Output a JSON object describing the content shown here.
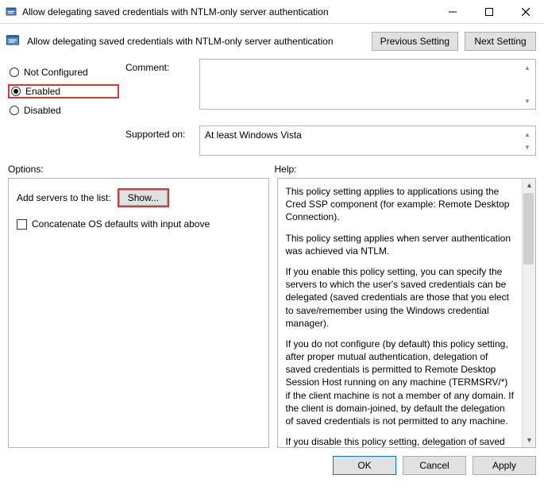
{
  "window": {
    "title": "Allow delegating saved credentials with NTLM-only server authentication"
  },
  "header": {
    "title": "Allow delegating saved credentials with NTLM-only server authentication",
    "prev_btn": "Previous Setting",
    "next_btn": "Next Setting"
  },
  "state": {
    "not_configured": "Not Configured",
    "enabled": "Enabled",
    "disabled": "Disabled",
    "selected": "enabled"
  },
  "labels": {
    "comment": "Comment:",
    "supported": "Supported on:",
    "options": "Options:",
    "help": "Help:"
  },
  "supported_text": "At least Windows Vista",
  "options": {
    "add_servers_label": "Add servers to the list:",
    "show_btn": "Show...",
    "checkbox_label": "Concatenate OS defaults with input above"
  },
  "help": {
    "p1": "This policy setting applies to applications using the Cred SSP component (for example: Remote Desktop Connection).",
    "p2": "This policy setting applies when server authentication was achieved via NTLM.",
    "p3": "If you enable this policy setting, you can specify the servers to which the user's saved credentials can be delegated (saved credentials are those that you elect to save/remember using the Windows credential manager).",
    "p4": "If you do not configure (by default) this policy setting, after proper mutual authentication, delegation of saved credentials is permitted to Remote Desktop Session Host running on any machine (TERMSRV/*) if the client machine is not a member of any domain. If the client is domain-joined, by default the delegation of saved credentials is not permitted to any machine.",
    "p5": "If you disable this policy setting, delegation of saved credentials is not permitted to any machine."
  },
  "footer": {
    "ok": "OK",
    "cancel": "Cancel",
    "apply": "Apply"
  }
}
